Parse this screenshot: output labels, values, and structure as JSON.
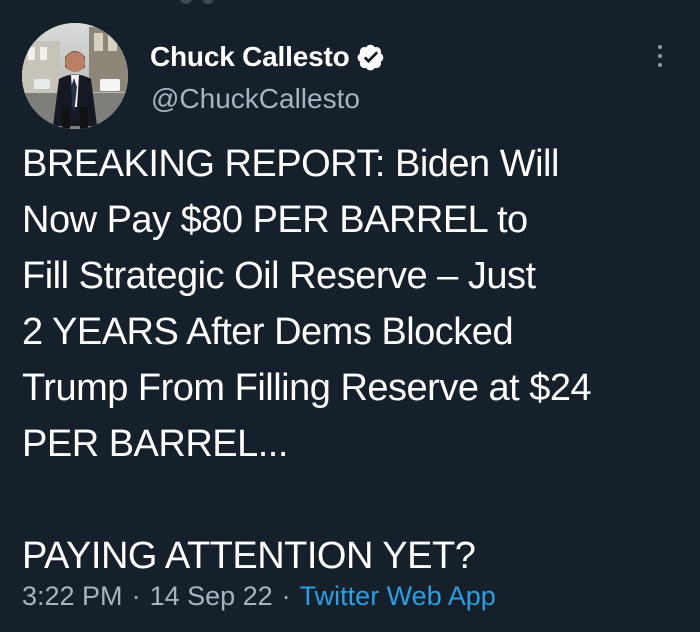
{
  "tweet": {
    "author": {
      "display_name": "Chuck Callesto",
      "handle": "@ChuckCallesto",
      "verified_icon": "verified-badge-icon",
      "avatar_icon": "profile-photo-avatar"
    },
    "text_lines": [
      "BREAKING REPORT: Biden Will",
      "Now Pay $80 PER BARREL to",
      "Fill Strategic Oil Reserve – Just",
      "2 YEARS After Dems Blocked",
      "Trump From Filling Reserve at $24",
      "PER BARREL...",
      "",
      "PAYING ATTENTION YET?"
    ],
    "meta": {
      "time": "3:22 PM",
      "separator_1": "·",
      "date": "14 Sep 22",
      "separator_2": "·",
      "source": "Twitter Web App"
    },
    "menu_icon": "more-options-icon"
  },
  "colors": {
    "background": "#15202b",
    "primary_text": "#ffffff",
    "secondary_text": "#a7b3bf",
    "link": "#2a9fe3"
  }
}
